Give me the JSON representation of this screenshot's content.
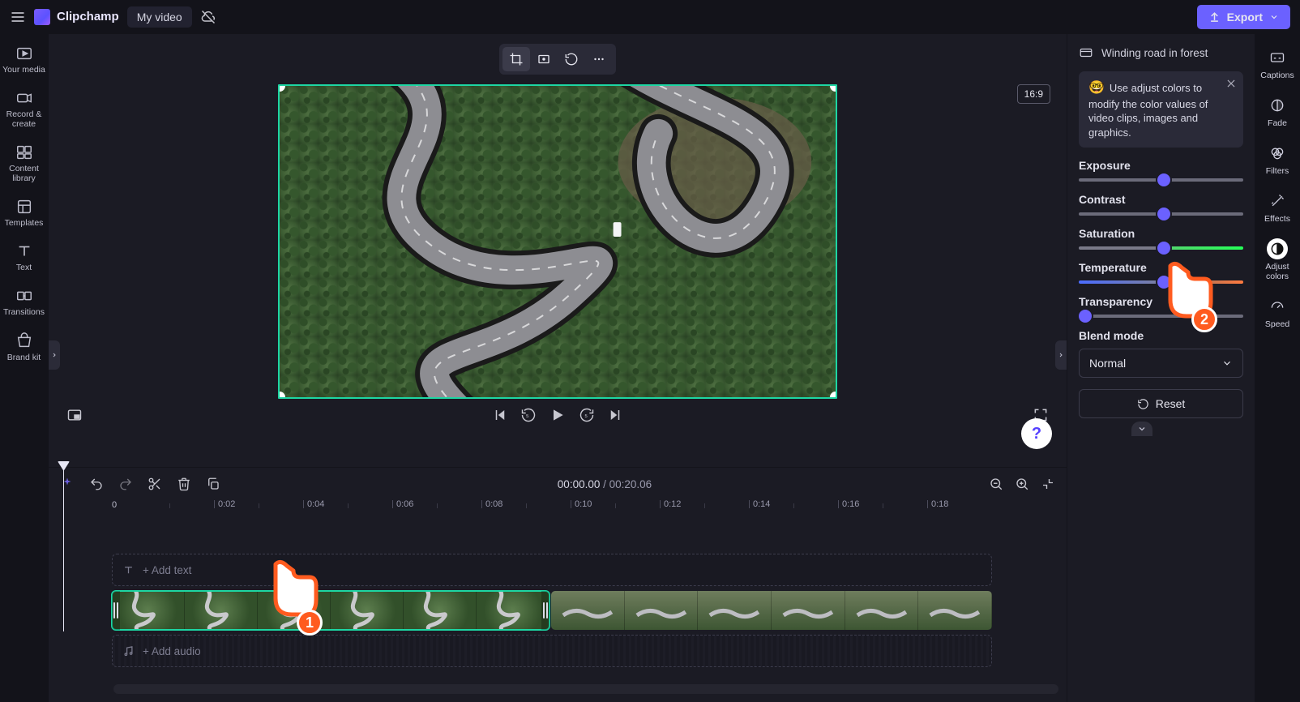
{
  "brand": {
    "name": "Clipchamp"
  },
  "topbar": {
    "projectTitle": "My video",
    "export": "Export"
  },
  "leftRail": {
    "items": [
      {
        "label": "Your media"
      },
      {
        "label": "Record & create"
      },
      {
        "label": "Content library"
      },
      {
        "label": "Templates"
      },
      {
        "label": "Text"
      },
      {
        "label": "Transitions"
      },
      {
        "label": "Brand kit"
      }
    ]
  },
  "preview": {
    "aspect": "16:9"
  },
  "transport": {
    "currentTime": "00:00.00",
    "duration": "00:20.06"
  },
  "ruler": {
    "zero": "0",
    "ticks": [
      "0:02",
      "0:04",
      "0:06",
      "0:08",
      "0:10",
      "0:12",
      "0:14",
      "0:16",
      "0:18"
    ]
  },
  "tracks": {
    "addText": "+ Add text",
    "addAudio": "+ Add audio"
  },
  "propsPanel": {
    "clipTitle": "Winding road in forest",
    "tip": "Use adjust colors to modify the color values of video clips, images and graphics.",
    "sliders": {
      "exposure": {
        "label": "Exposure",
        "pos": 48,
        "trackClass": "track-plain"
      },
      "contrast": {
        "label": "Contrast",
        "pos": 48,
        "trackClass": "track-plain"
      },
      "saturation": {
        "label": "Saturation",
        "pos": 48,
        "trackClass": "track-sat"
      },
      "temperature": {
        "label": "Temperature",
        "pos": 48,
        "trackClass": "track-temp"
      },
      "transparency": {
        "label": "Transparency",
        "pos": 0,
        "trackClass": "track-plain"
      }
    },
    "blendMode": {
      "label": "Blend mode",
      "value": "Normal"
    },
    "reset": "Reset"
  },
  "rightRail": {
    "items": [
      {
        "label": "Captions"
      },
      {
        "label": "Fade"
      },
      {
        "label": "Filters"
      },
      {
        "label": "Effects"
      },
      {
        "label": "Adjust colors"
      },
      {
        "label": "Speed"
      }
    ]
  },
  "help": "?",
  "pointers": {
    "p1": "1",
    "p2": "2"
  }
}
